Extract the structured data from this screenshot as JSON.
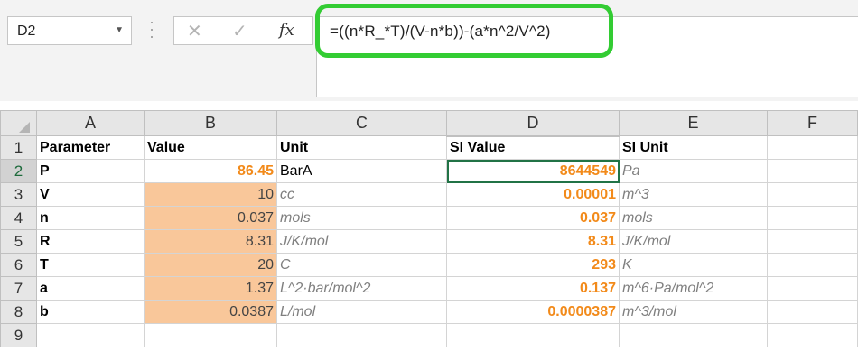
{
  "name_box": {
    "cell_ref": "D2",
    "dropdown_icon": "chevron-down-icon"
  },
  "formula_bar": {
    "cancel_icon": "✕",
    "enter_icon": "✓",
    "fx_label": "fx",
    "formula": "=((n*R_*T)/(V-n*b))-(a*n^2/V^2)",
    "highlight_color": "#33cc33"
  },
  "columns": [
    "A",
    "B",
    "C",
    "D",
    "E",
    "F"
  ],
  "rows": [
    {
      "num": "1",
      "a": "Parameter",
      "b": "Value",
      "c": "Unit",
      "d": "SI Value",
      "e": "SI Unit"
    },
    {
      "num": "2",
      "a": "P",
      "b": "86.45",
      "c": "BarA",
      "d": "8644549",
      "e": "Pa"
    },
    {
      "num": "3",
      "a": "V",
      "b": "10",
      "c": "cc",
      "d": "0.00001",
      "e": "m^3"
    },
    {
      "num": "4",
      "a": "n",
      "b": "0.037",
      "c": "mols",
      "d": "0.037",
      "e": "mols"
    },
    {
      "num": "5",
      "a": "R",
      "b": "8.31",
      "c": "J/K/mol",
      "d": "8.31",
      "e": "J/K/mol"
    },
    {
      "num": "6",
      "a": "T",
      "b": "20",
      "c": "C",
      "d": "293",
      "e": "K"
    },
    {
      "num": "7",
      "a": "a",
      "b": "1.37",
      "c": "L^2·bar/mol^2",
      "d": "0.137",
      "e": "m^6·Pa/mol^2"
    },
    {
      "num": "8",
      "a": "b",
      "b": "0.0387",
      "c": "L/mol",
      "d": "0.0000387",
      "e": "m^3/mol"
    },
    {
      "num": "9"
    }
  ],
  "colors": {
    "input_fill": "#f9c79a",
    "si_value_text": "#f28a1a",
    "selection": "#217346"
  }
}
